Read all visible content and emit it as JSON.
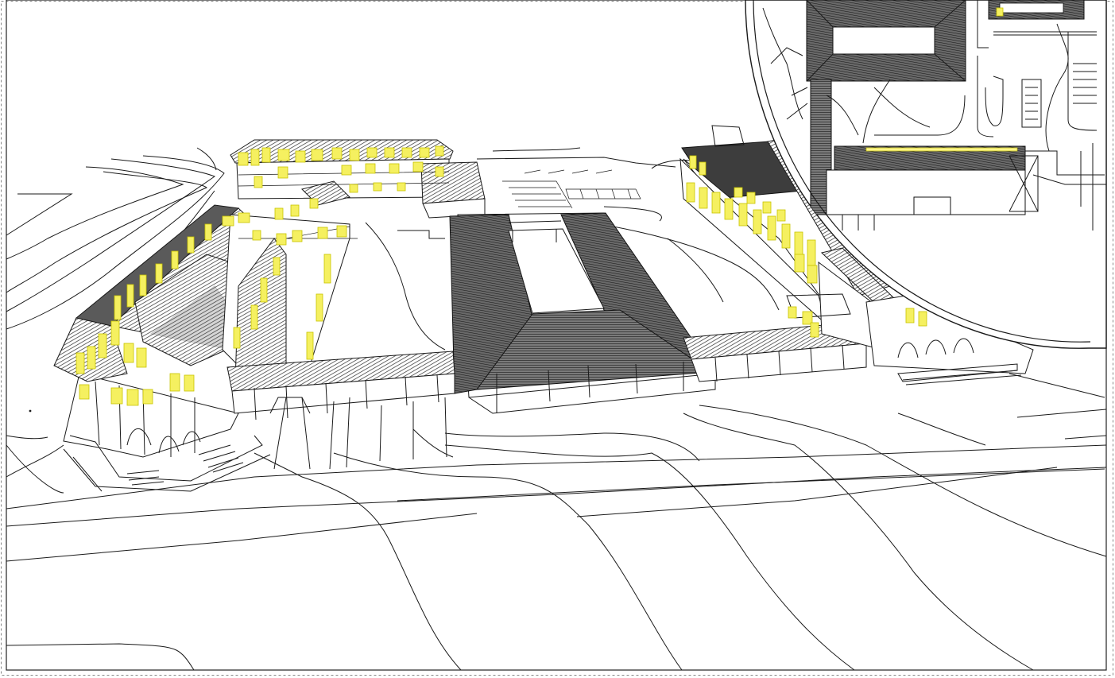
{
  "drawing": {
    "kind": "3D wireframe site model with plan inset",
    "highlight_color": "#f5f060",
    "roof_color": "#4a4a4a",
    "line_color": "#1a1a1a"
  }
}
